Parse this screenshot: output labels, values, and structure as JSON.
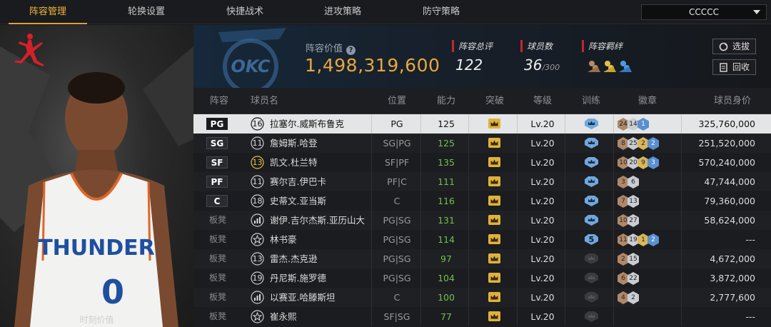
{
  "nav": {
    "tabs": [
      "阵容管理",
      "轮换设置",
      "快捷战术",
      "进攻策略",
      "防守策略"
    ],
    "active_tab": "阵容管理",
    "team_select": "CCCCC"
  },
  "left_panel": {
    "brand_logo": "jordan-jumpman-logo",
    "player_jersey_text": "THUNDER",
    "player_jersey_number": "0",
    "caption": "时刻价值"
  },
  "header": {
    "team_logo": "okc-thunder-logo",
    "lineup_value_label": "阵容价值",
    "lineup_value": "1,498,319,600",
    "overall_label": "阵容总评",
    "overall_value": "122",
    "players_label": "球员数",
    "players_value": "36",
    "players_max": "/300",
    "chemistry_label": "阵容羁绊",
    "select_button": "选拔",
    "recycle_button": "回收"
  },
  "table": {
    "headers": [
      "阵容",
      "球员名",
      "位置",
      "能力",
      "突破",
      "等级",
      "训练",
      "徽章",
      "球员身价"
    ],
    "rows": [
      {
        "slot": "PG",
        "bench": false,
        "number": "16",
        "name": "拉塞尔.威斯布鲁克",
        "position": "PG",
        "rating": "125",
        "green": false,
        "level": "Lv.20",
        "train": "",
        "badges": [
          [
            "24",
            "br"
          ],
          [
            "14",
            "sv"
          ],
          [
            "1",
            "bl"
          ]
        ],
        "price": "325,760,000",
        "selected": true
      },
      {
        "slot": "SG",
        "bench": false,
        "number": "11",
        "name": "詹姆斯.哈登",
        "position": "SG|PG",
        "rating": "125",
        "green": true,
        "level": "Lv.20",
        "train": "",
        "badges": [
          [
            "8",
            "br"
          ],
          [
            "25",
            "sv"
          ],
          [
            "2",
            "gd"
          ],
          [
            "2",
            "bl"
          ]
        ],
        "price": "251,520,000",
        "selected": false
      },
      {
        "slot": "SF",
        "bench": false,
        "number": "13",
        "name": "凯文.杜兰特",
        "position": "SF|PF",
        "rating": "135",
        "green": true,
        "level": "Lv.20",
        "train": "",
        "badges": [
          [
            "10",
            "br"
          ],
          [
            "20",
            "sv"
          ],
          [
            "9",
            "gd"
          ],
          [
            "3",
            "bl"
          ]
        ],
        "price": "570,240,000",
        "selected": false
      },
      {
        "slot": "PF",
        "bench": false,
        "number": "11",
        "name": "赛尔吉.伊巴卡",
        "position": "PF|C",
        "rating": "111",
        "green": true,
        "level": "Lv.20",
        "train": "",
        "badges": [
          [
            "3",
            "br"
          ],
          [
            "6",
            "sv"
          ]
        ],
        "price": "47,744,000",
        "selected": false
      },
      {
        "slot": "C",
        "bench": false,
        "number": "18",
        "name": "史蒂文.亚当斯",
        "position": "C",
        "rating": "116",
        "green": true,
        "level": "Lv.20",
        "train": "",
        "badges": [
          [
            "7",
            "br"
          ],
          [
            "13",
            "sv"
          ]
        ],
        "price": "79,360,000",
        "selected": false
      },
      {
        "slot": "板凳",
        "bench": true,
        "number": "",
        "name": "谢伊.吉尔杰斯.亚历山大",
        "position": "PG|SG",
        "rating": "131",
        "green": true,
        "level": "Lv.20",
        "train": "",
        "badges": [
          [
            "10",
            "br"
          ],
          [
            "27",
            "sv"
          ]
        ],
        "price": "58,624,000",
        "selected": false
      },
      {
        "slot": "板凳",
        "bench": true,
        "number": "",
        "name": "林书豪",
        "position": "PG|SG",
        "rating": "114",
        "green": true,
        "level": "Lv.20",
        "train": "5",
        "badges": [
          [
            "11",
            "br"
          ],
          [
            "19",
            "sv"
          ],
          [
            "1",
            "gd"
          ],
          [
            "2",
            "bl"
          ]
        ],
        "price": "---",
        "selected": false
      },
      {
        "slot": "板凳",
        "bench": true,
        "number": "13",
        "name": "雷杰.杰克逊",
        "position": "PG|SG",
        "rating": "97",
        "green": true,
        "level": "Lv.20",
        "train": "",
        "badges": [
          [
            "2",
            "br"
          ],
          [
            "15",
            "sv"
          ]
        ],
        "price": "4,672,000",
        "selected": false
      },
      {
        "slot": "板凳",
        "bench": true,
        "number": "19",
        "name": "丹尼斯.施罗德",
        "position": "PG|SG",
        "rating": "104",
        "green": true,
        "level": "Lv.20",
        "train": "",
        "badges": [
          [
            "6",
            "br"
          ],
          [
            "22",
            "sv"
          ]
        ],
        "price": "3,872,000",
        "selected": false
      },
      {
        "slot": "板凳",
        "bench": true,
        "number": "",
        "name": "以赛亚.哈滕斯坦",
        "position": "C",
        "rating": "100",
        "green": true,
        "level": "Lv.20",
        "train": "",
        "badges": [
          [
            "4",
            "br"
          ],
          [
            "2",
            "sv"
          ]
        ],
        "price": "2,777,600",
        "selected": false
      },
      {
        "slot": "板凳",
        "bench": true,
        "number": "",
        "name": "崔永熙",
        "position": "SF|SG",
        "rating": "77",
        "green": true,
        "level": "Lv.20",
        "train": "",
        "badges": [],
        "price": "---",
        "selected": false
      }
    ]
  }
}
